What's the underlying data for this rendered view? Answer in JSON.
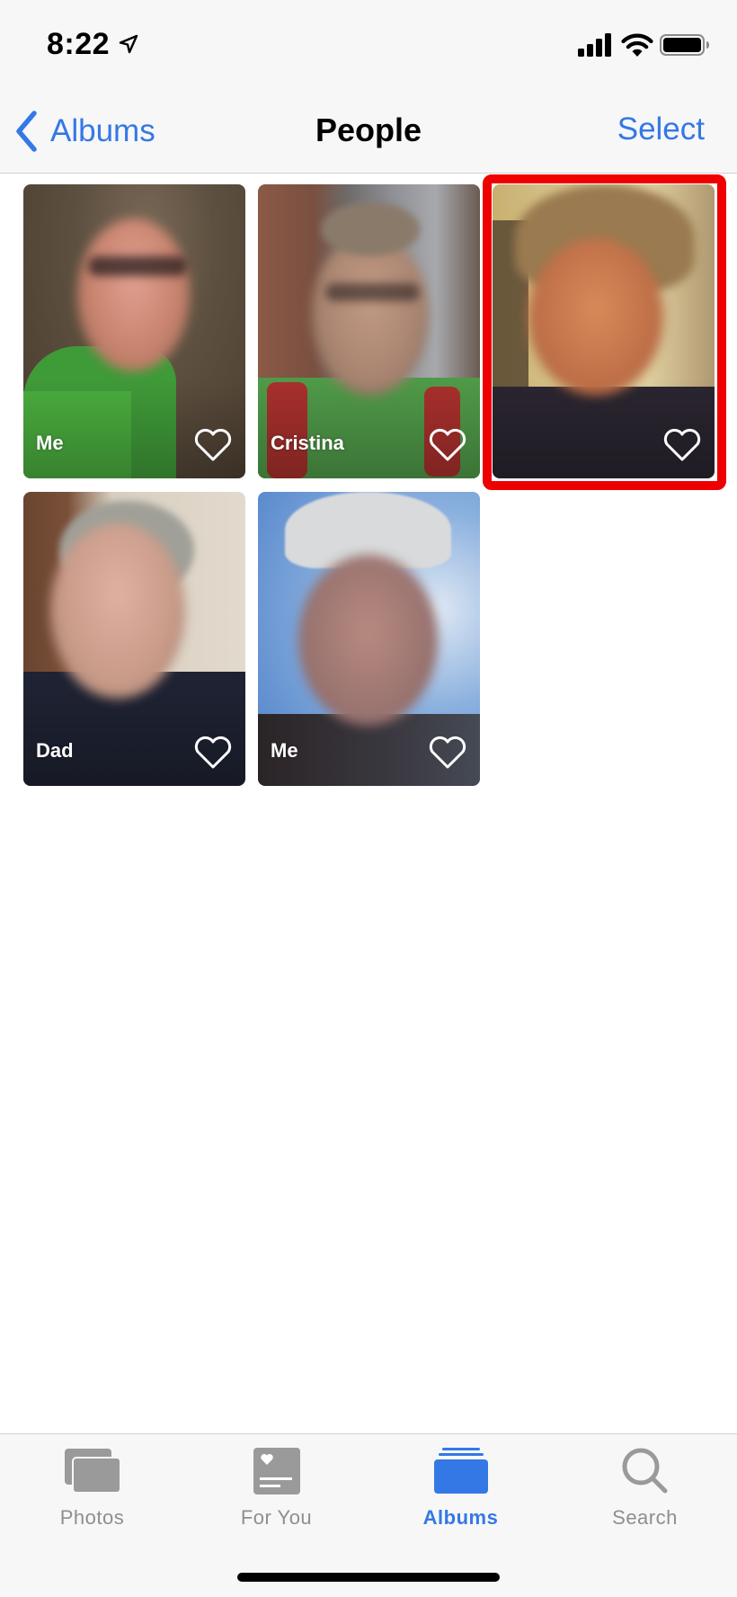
{
  "status_bar": {
    "time": "8:22",
    "icons": [
      "location-arrow-icon",
      "cellular-signal-icon",
      "wifi-icon",
      "battery-icon"
    ]
  },
  "nav": {
    "back_label": "Albums",
    "title": "People",
    "select_label": "Select"
  },
  "people": [
    {
      "name": "Me",
      "favorite": false
    },
    {
      "name": "Cristina",
      "favorite": false
    },
    {
      "name": "",
      "favorite": false,
      "highlighted": true
    },
    {
      "name": "Dad",
      "favorite": false
    },
    {
      "name": "Me",
      "favorite": false
    }
  ],
  "highlight_color": "#ee0000",
  "tabs": [
    {
      "label": "Photos",
      "icon": "photos-icon",
      "active": false
    },
    {
      "label": "For You",
      "icon": "for-you-icon",
      "active": false
    },
    {
      "label": "Albums",
      "icon": "albums-icon",
      "active": true
    },
    {
      "label": "Search",
      "icon": "search-icon",
      "active": false
    }
  ],
  "colors": {
    "accent": "#3478e6",
    "inactive": "#8e8e93",
    "bar_background": "#f7f7f7"
  }
}
